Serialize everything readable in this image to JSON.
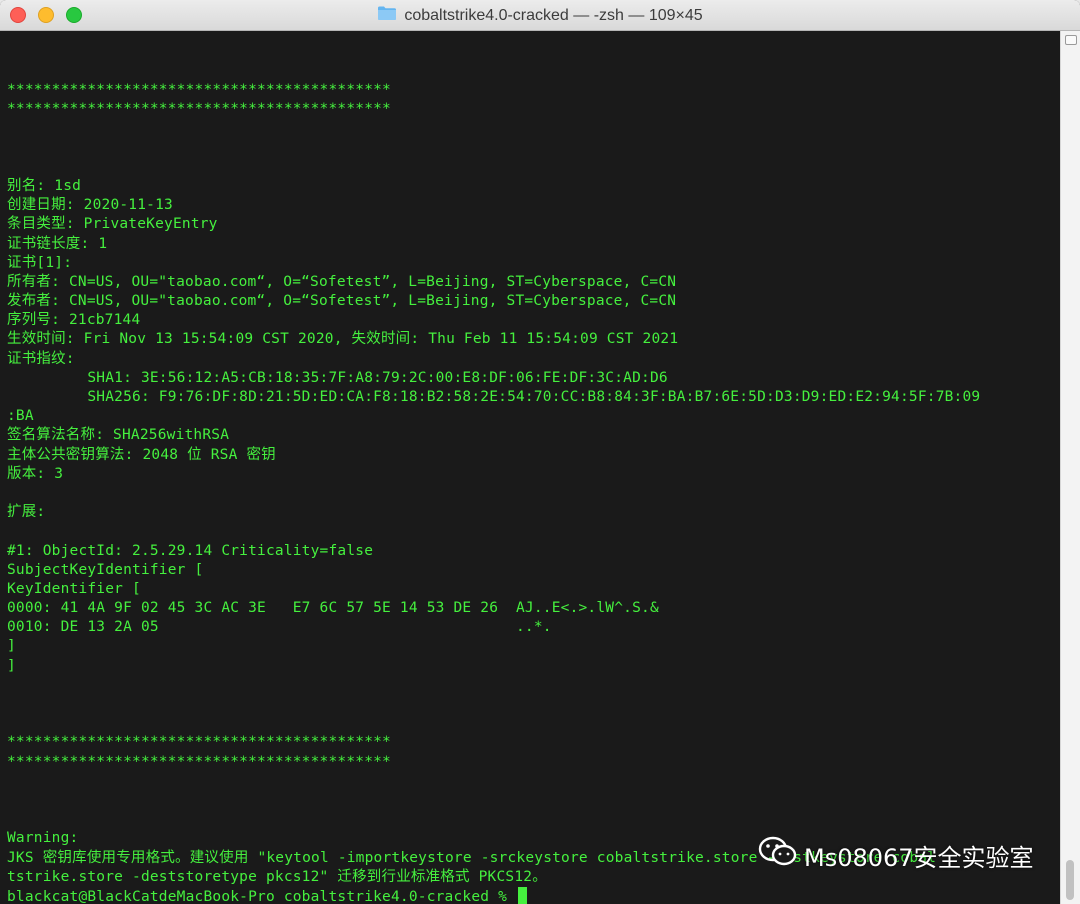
{
  "window": {
    "title": "cobaltstrike4.0-cracked — -zsh — 109×45",
    "folder_icon": "folder-icon"
  },
  "colors": {
    "terminal_bg": "#1a1a1a",
    "terminal_text": "#45f03e"
  },
  "terminal": {
    "lines": [
      "*******************************************",
      "*******************************************",
      "",
      "",
      "",
      "别名: 1sd",
      "创建日期: 2020-11-13",
      "条目类型: PrivateKeyEntry",
      "证书链长度: 1",
      "证书[1]:",
      "所有者: CN=US, OU=\"taobao.com“, O=“Sofetest”, L=Beijing, ST=Cyberspace, C=CN",
      "发布者: CN=US, OU=\"taobao.com“, O=“Sofetest”, L=Beijing, ST=Cyberspace, C=CN",
      "序列号: 21cb7144",
      "生效时间: Fri Nov 13 15:54:09 CST 2020, 失效时间: Thu Feb 11 15:54:09 CST 2021",
      "证书指纹:",
      "         SHA1: 3E:56:12:A5:CB:18:35:7F:A8:79:2C:00:E8:DF:06:FE:DF:3C:AD:D6",
      "         SHA256: F9:76:DF:8D:21:5D:ED:CA:F8:18:B2:58:2E:54:70:CC:B8:84:3F:BA:B7:6E:5D:D3:D9:ED:E2:94:5F:7B:09",
      ":BA",
      "签名算法名称: SHA256withRSA",
      "主体公共密钥算法: 2048 位 RSA 密钥",
      "版本: 3",
      "",
      "扩展:",
      "",
      "#1: ObjectId: 2.5.29.14 Criticality=false",
      "SubjectKeyIdentifier [",
      "KeyIdentifier [",
      "0000: 41 4A 9F 02 45 3C AC 3E   E7 6C 57 5E 14 53 DE 26  AJ..E<.>.lW^.S.&",
      "0010: DE 13 2A 05                                        ..*.",
      "]",
      "]",
      "",
      "",
      "",
      "*******************************************",
      "*******************************************",
      "",
      "",
      "",
      "Warning:",
      "JKS 密钥库使用专用格式。建议使用 \"keytool -importkeystore -srckeystore cobaltstrike.store -destkeystore cobal",
      "tstrike.store -deststoretype pkcs12\" 迁移到行业标准格式 PKCS12。"
    ],
    "prompt": "blackcat@BlackCatdeMacBook-Pro cobaltstrike4.0-cracked % "
  },
  "watermark": {
    "text": "Ms08067安全实验室",
    "icon": "wechat-icon"
  }
}
